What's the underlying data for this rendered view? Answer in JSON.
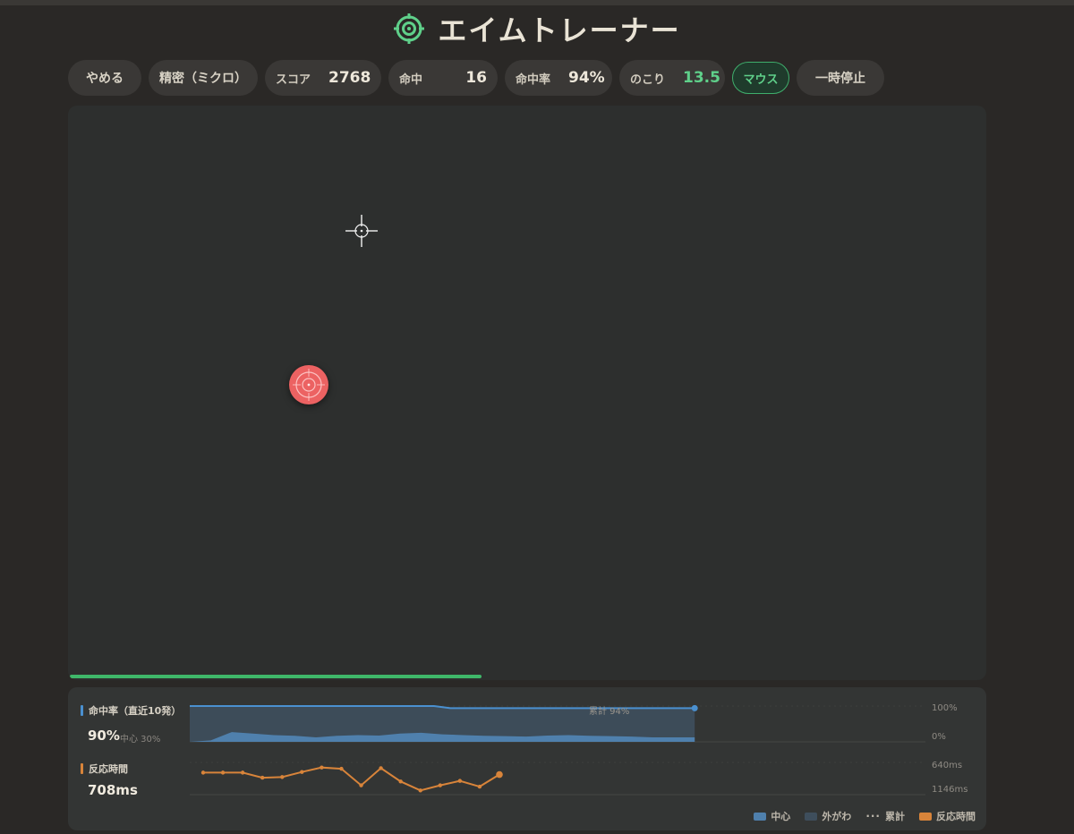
{
  "app": {
    "title": "エイムトレーナー",
    "accent_color": "#5fd08a",
    "title_icon": "target-icon"
  },
  "toolbar": {
    "quit_label": "やめる",
    "mode_label": "精密（ミクロ）",
    "score_label": "スコア",
    "score_value": "2768",
    "hits_label": "命中",
    "hits_value": "16",
    "accuracy_label": "命中率",
    "accuracy_value": "94%",
    "remaining_label": "のこり",
    "remaining_value": "13.5",
    "input_label": "マウス",
    "pause_label": "一時停止"
  },
  "field": {
    "progress": 0.45,
    "crosshair_icon": "crosshair-icon",
    "target_color": "#ec6262"
  },
  "stats": {
    "accuracy": {
      "label": "命中率（直近10発）",
      "value": "90%",
      "center_note": "中心 30%",
      "cumulative_label": "累計 94%",
      "axis_top": "100%",
      "axis_bottom": "0%",
      "color": "#4a90d0"
    },
    "reaction": {
      "label": "反応時間",
      "value": "708ms",
      "axis_top": "640ms",
      "axis_bottom": "1146ms",
      "color": "#d8843a"
    },
    "legend": {
      "center": "中心",
      "outer": "外がわ",
      "cumulative": "累計",
      "reaction": "反応時間"
    }
  },
  "chart_data": [
    {
      "type": "area",
      "xlabel": "",
      "ylabel": "",
      "ylim": [
        0,
        100
      ],
      "series": [
        {
          "name": "累計",
          "values": [
            100,
            100,
            100,
            100,
            100,
            100,
            100,
            100,
            100,
            100,
            100,
            100,
            100,
            100,
            100,
            100,
            94,
            94,
            94,
            94,
            94,
            94,
            94,
            94,
            94,
            94,
            94,
            94,
            94,
            94,
            94,
            94
          ]
        },
        {
          "name": "中心",
          "values": [
            0,
            10,
            65,
            55,
            45,
            40,
            30,
            40,
            45,
            42,
            55,
            60,
            50,
            45,
            40,
            38,
            35,
            42,
            45,
            40,
            38,
            35,
            30,
            30,
            30
          ]
        }
      ]
    },
    {
      "type": "line",
      "xlabel": "",
      "ylabel": "",
      "ylim": [
        1146,
        640
      ],
      "series": [
        {
          "name": "反応時間",
          "values": [
            800,
            800,
            800,
            880,
            870,
            790,
            720,
            740,
            1000,
            730,
            940,
            1080,
            1000,
            930,
            1020,
            830
          ]
        }
      ]
    }
  ]
}
